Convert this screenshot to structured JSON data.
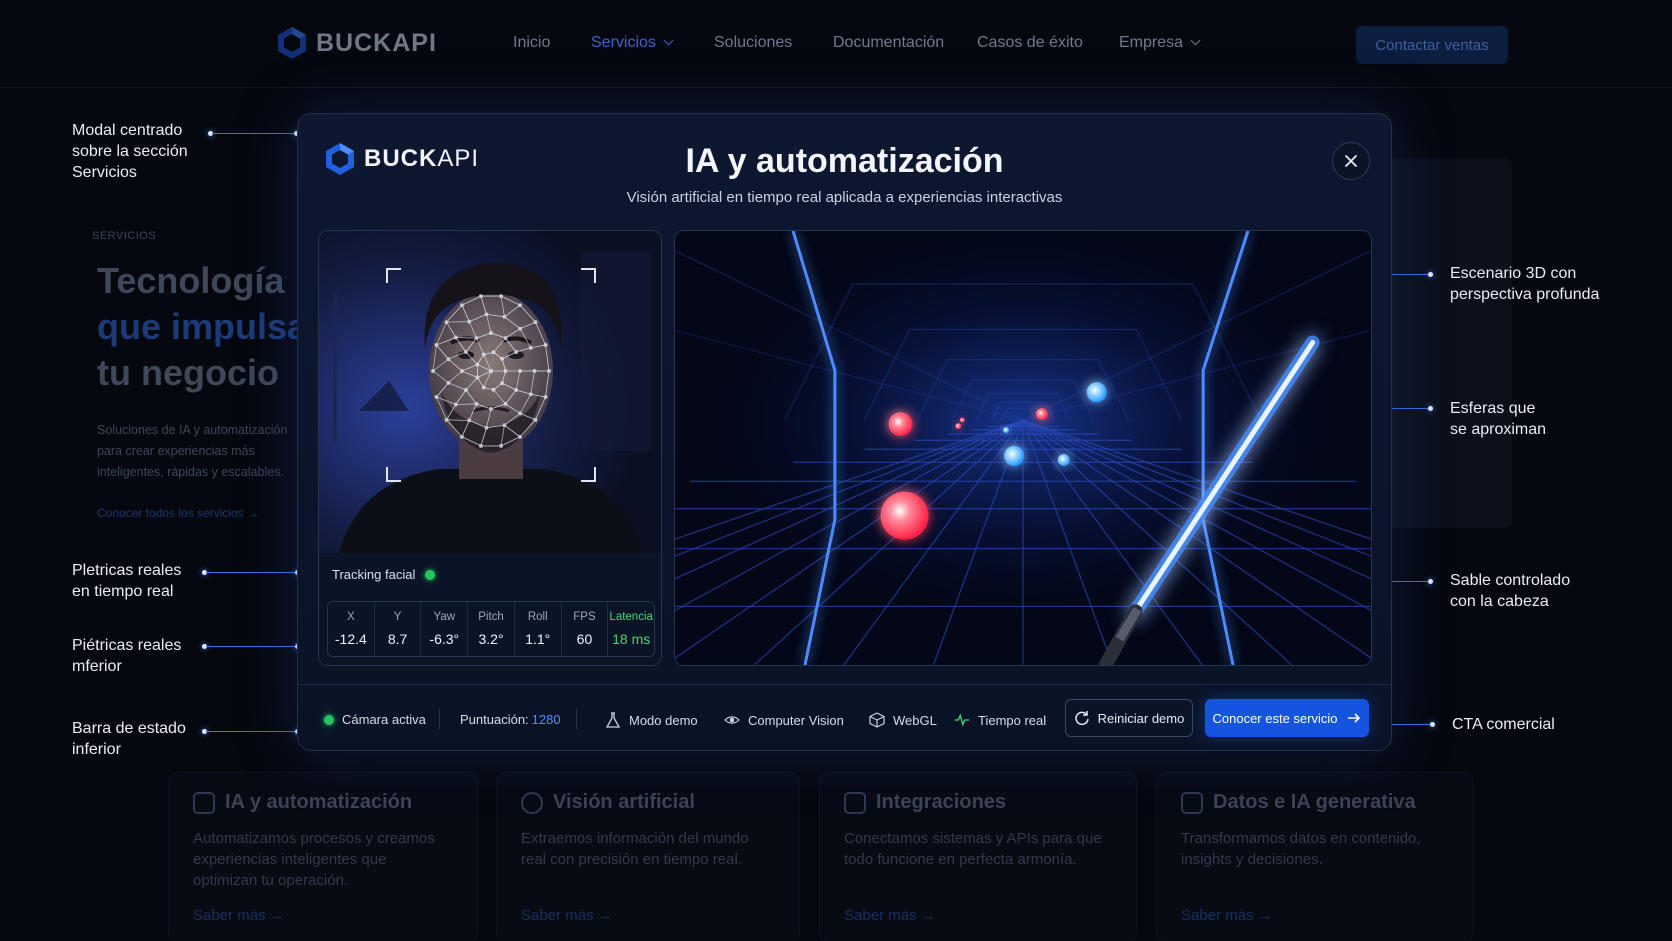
{
  "nav": {
    "logo": "BUCKAPI",
    "links": [
      {
        "label": "Inicio",
        "active": false
      },
      {
        "label": "Servicios",
        "active": true,
        "dropdown": true
      },
      {
        "label": "Soluciones",
        "active": false
      },
      {
        "label": "Documentación",
        "active": false
      },
      {
        "label": "Casos de éxito",
        "active": false
      },
      {
        "label": "Empresa",
        "active": false,
        "dropdown": true
      }
    ],
    "cta": "Contactar ventas"
  },
  "hero": {
    "tag": "SERVICIOS",
    "title_line1": "Tecnología",
    "title_line2": "que impulsa",
    "title_line3": "tu negocio",
    "description": "Soluciones de IA y automatización para crear experiencias más inteligentes, rápidas y escalables.",
    "link": "Conocer todos los servicios →"
  },
  "cards": [
    {
      "title": "IA y automatización",
      "description": "Automatizamos procesos y creamos experiencias inteligentes que optimizan tu operación.",
      "link": "Saber más →"
    },
    {
      "title": "Visión artificial",
      "description": "Extraemos información del mundo real con precisión en tiempo real.",
      "link": "Saber más →"
    },
    {
      "title": "Integraciones",
      "description": "Conectamos sistemas y APIs para que todo funcione en perfecta armonía.",
      "link": "Saber más →"
    },
    {
      "title": "Datos e IA generativa",
      "description": "Transformamos datos en contenido, insights y decisiones.",
      "link": "Saber más →"
    }
  ],
  "annotations": {
    "modal": "Modal centrado\nsobre la sección\nServicios",
    "metrics1": "Pletricas reales\nen tiempo real",
    "metrics2": "Piétricas reales\nmferior",
    "statusbar": "Barra de estado\ninferior",
    "scene": "Escenario 3D con\nperspectiva profunda",
    "spheres": "Esferas que\nse aproximan",
    "saber": "Sable controlado\ncon la cabeza",
    "cta": "CTA comercial"
  },
  "modal": {
    "logo_bold": "BUCK",
    "logo_thin": "API",
    "title": "IA y automatización",
    "subtitle": "Visión artificial en tiempo real aplicada a experiencias interactivas",
    "tracking_label": "Tracking facial",
    "metrics": [
      {
        "label": "X",
        "value": "-12.4"
      },
      {
        "label": "Y",
        "value": "8.7"
      },
      {
        "label": "Yaw",
        "value": "-6.3°"
      },
      {
        "label": "Pitch",
        "value": "3.2°"
      },
      {
        "label": "Roll",
        "value": "1.1°"
      },
      {
        "label": "FPS",
        "value": "60"
      },
      {
        "label": "Latencia",
        "value": "18 ms"
      }
    ],
    "status": {
      "camera": "Cámara activa",
      "score_label": "Puntuación:",
      "score_value": "1280",
      "demo_mode": "Modo demo",
      "cv": "Computer Vision",
      "webgl": "WebGL",
      "realtime": "Tiempo real",
      "reset": "Reiniciar demo",
      "cta": "Conocer este servicio"
    }
  },
  "colors": {
    "accent": "#1554e0",
    "score": "#4f8bff",
    "live": "#22c55e",
    "saber": "#3d8bff",
    "sphere_red": "#ff3355",
    "sphere_blue": "#3aa8ff"
  }
}
